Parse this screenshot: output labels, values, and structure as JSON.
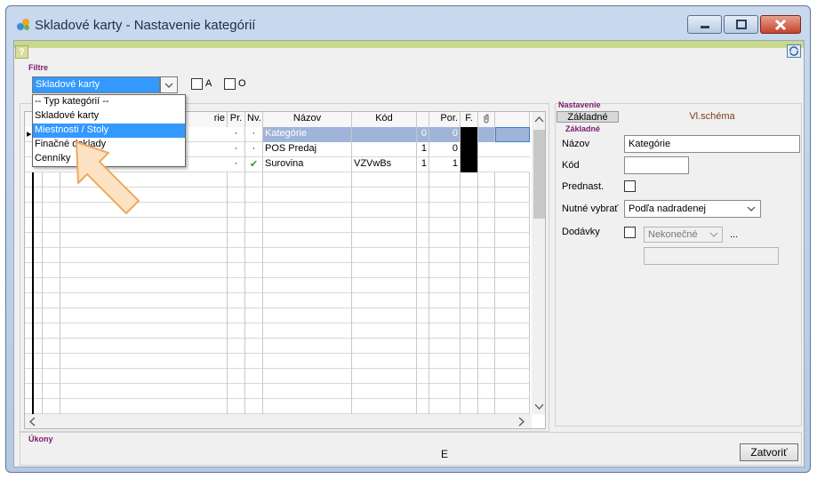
{
  "window": {
    "title": "Skladové karty - Nastavenie kategórií"
  },
  "toolbar": {
    "help": "?"
  },
  "filter": {
    "label": "Filtre",
    "selected": "Skladové karty",
    "options": [
      "-- Typ kategórií --",
      "Skladové karty",
      "Miestnosti / Stoly",
      "Finačné doklady",
      "Cenníky"
    ],
    "highlighted_index": 2,
    "check_a": "A",
    "check_o": "O"
  },
  "grid": {
    "columns": [
      "rie",
      "Pr.",
      "Nv.",
      "Názov",
      "Kód",
      "Por.",
      "F."
    ],
    "rows": [
      {
        "pr": "·",
        "nv": "·",
        "name": "Kategórie",
        "kod": "",
        "n1": "0",
        "por": "0",
        "f_color": "#000000",
        "selected": true
      },
      {
        "pr": "·",
        "nv": "·",
        "name": "POS Predaj",
        "kod": "",
        "n1": "1",
        "por": "0",
        "f_color": "#000000",
        "selected": false
      },
      {
        "pr": "·",
        "nv": "✔",
        "name": "Surovina",
        "kod": "VZVwBs",
        "n1": "1",
        "por": "1",
        "f_color": "#000000",
        "selected": false
      }
    ]
  },
  "settings": {
    "label": "Nastavenie",
    "tab_zakladne": "Základné",
    "tab_vlschema": "Vl.schéma",
    "section": "Základné",
    "nazov_label": "Názov",
    "nazov_value": "Kategórie",
    "kod_label": "Kód",
    "kod_value": "",
    "prednast_label": "Prednast.",
    "nutne_label": "Nutné vybrať",
    "nutne_value": "Podľa nadradenej",
    "dodavky_label": "Dodávky",
    "dodavky_value": "Nekonečné",
    "dots": "..."
  },
  "actions": {
    "label": "Úkony",
    "center_text": "E",
    "close_label": "Zatvoriť"
  },
  "colors": {
    "accent": "#3399ff",
    "group_label": "#7a1c6c",
    "top_strip": "#c8d98c"
  }
}
